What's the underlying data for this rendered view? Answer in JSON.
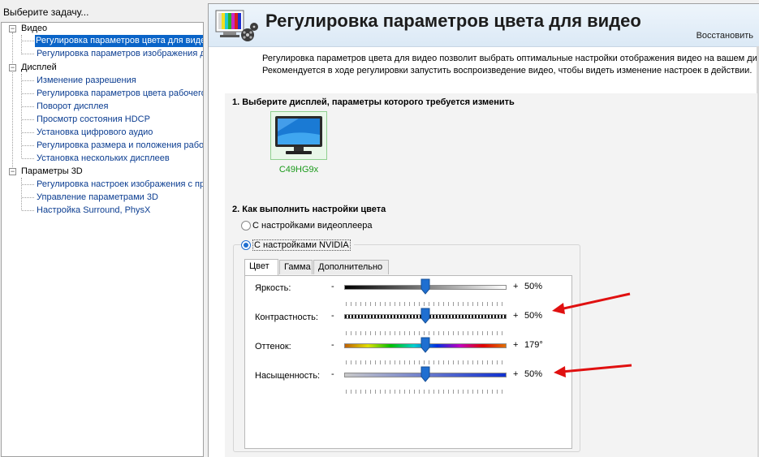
{
  "task_pane": {
    "header": "Выберите задачу...",
    "tree": [
      {
        "label": "Видео",
        "type": "category",
        "expanded": true
      },
      {
        "label": "Регулировка параметров цвета для видео",
        "type": "item",
        "selected": true
      },
      {
        "label": "Регулировка параметров изображения для видео",
        "type": "item"
      },
      {
        "label": "Дисплей",
        "type": "category",
        "expanded": true
      },
      {
        "label": "Изменение разрешения",
        "type": "item"
      },
      {
        "label": "Регулировка параметров цвета рабочего стола",
        "type": "item"
      },
      {
        "label": "Поворот дисплея",
        "type": "item"
      },
      {
        "label": "Просмотр состояния HDCP",
        "type": "item"
      },
      {
        "label": "Установка цифрового аудио",
        "type": "item"
      },
      {
        "label": "Регулировка размера и положения рабочего стола",
        "type": "item"
      },
      {
        "label": "Установка нескольких дисплеев",
        "type": "item"
      },
      {
        "label": "Параметры 3D",
        "type": "category",
        "expanded": true
      },
      {
        "label": "Регулировка настроек изображения с просмотром",
        "type": "item"
      },
      {
        "label": "Управление параметрами 3D",
        "type": "item"
      },
      {
        "label": "Настройка Surround, PhysX",
        "type": "item"
      }
    ]
  },
  "page": {
    "title": "Регулировка параметров цвета для видео",
    "restore_label": "Восстановить",
    "description_line1": "Регулировка параметров цвета для видео позволит выбрать оптимальные настройки отображения видео на вашем дис",
    "description_line2": "Рекомендуется в ходе регулировки запустить воспроизведение видео, чтобы видеть изменение настроек в действии.",
    "step1_title": "1. Выберите дисплей, параметры которого требуется изменить",
    "display_name": "C49HG9x",
    "step2_title": "2. Как выполнить настройки цвета",
    "radio_player": "С настройками видеоплеера",
    "radio_nvidia": "С настройками NVIDIA",
    "tabs": [
      "Цвет",
      "Гамма",
      "Дополнительно"
    ],
    "sliders": [
      {
        "label": "Яркость:",
        "minus": "-",
        "plus": "+",
        "value_text": "50%",
        "position": 0.5
      },
      {
        "label": "Контрастность:",
        "minus": "-",
        "plus": "+",
        "value_text": "50%",
        "position": 0.5
      },
      {
        "label": "Оттенок:",
        "minus": "-",
        "plus": "+",
        "value_text": "179°",
        "position": 0.5
      },
      {
        "label": "Насыщенность:",
        "minus": "-",
        "plus": "+",
        "value_text": "50%",
        "position": 0.5
      }
    ]
  },
  "colors": {
    "selection": "#0a64c8",
    "link": "#0b3d91",
    "thumb": "#1f6fd1",
    "display_name": "#1a9a1a",
    "arrow": "#e01010"
  }
}
